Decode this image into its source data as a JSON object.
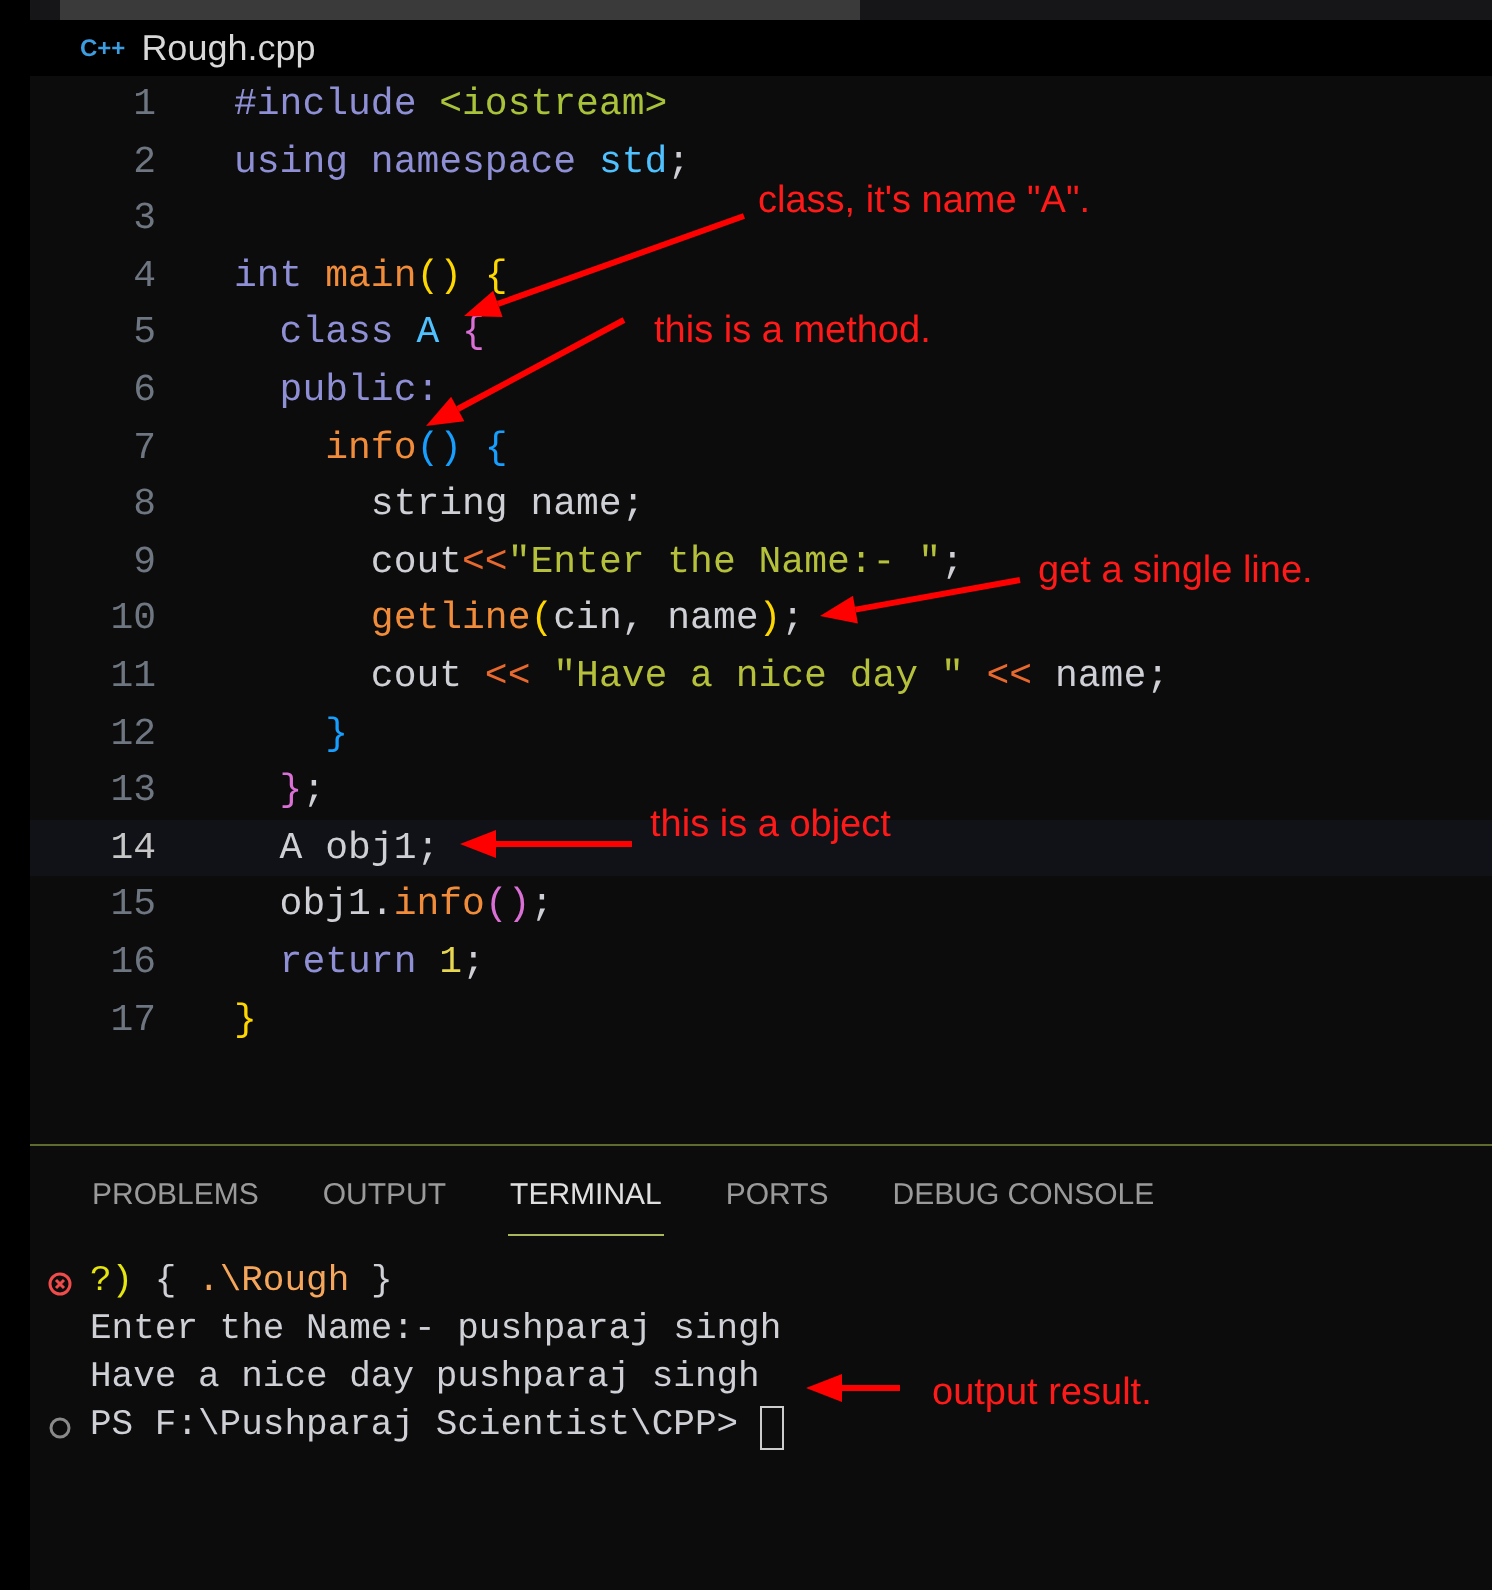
{
  "editor_tab": {
    "icon_text": "C++",
    "title": "Rough.cpp"
  },
  "code_lines": [
    {
      "number": "1",
      "selected": false,
      "tokens": [
        {
          "text": "#include ",
          "kind": "keyword"
        },
        {
          "text": "<iostream>",
          "kind": "include"
        }
      ]
    },
    {
      "number": "2",
      "selected": false,
      "tokens": [
        {
          "text": "using namespace ",
          "kind": "keyword"
        },
        {
          "text": "std",
          "kind": "type"
        },
        {
          "text": ";",
          "kind": "plain"
        }
      ]
    },
    {
      "number": "3",
      "selected": false
    },
    {
      "number": "4",
      "selected": false,
      "tokens": [
        {
          "text": "int ",
          "kind": "keyword"
        },
        {
          "text": "main",
          "kind": "function"
        },
        {
          "text": "() {",
          "kind": "bracket1"
        }
      ]
    },
    {
      "number": "5",
      "selected": false,
      "tokens": [
        {
          "text": "  class ",
          "kind": "keyword"
        },
        {
          "text": "A ",
          "kind": "type"
        },
        {
          "text": "{",
          "kind": "bracket2"
        }
      ]
    },
    {
      "number": "6",
      "selected": false,
      "tokens": [
        {
          "text": "  public:",
          "kind": "keyword"
        }
      ]
    },
    {
      "number": "7",
      "selected": false,
      "tokens": [
        {
          "text": "    info",
          "kind": "function"
        },
        {
          "text": "() {",
          "kind": "bracket3"
        }
      ]
    },
    {
      "number": "8",
      "selected": false,
      "tokens": [
        {
          "text": "      string name;",
          "kind": "plain"
        }
      ]
    },
    {
      "number": "9",
      "selected": false,
      "tokens": [
        {
          "text": "      cout",
          "kind": "plain"
        },
        {
          "text": "<<",
          "kind": "operator"
        },
        {
          "text": "\"Enter the Name:- \"",
          "kind": "string"
        },
        {
          "text": ";",
          "kind": "plain"
        }
      ]
    },
    {
      "number": "10",
      "selected": false,
      "tokens": [
        {
          "text": "      getline",
          "kind": "function"
        },
        {
          "text": "(",
          "kind": "bracket1"
        },
        {
          "text": "cin, name",
          "kind": "plain"
        },
        {
          "text": ")",
          "kind": "bracket1"
        },
        {
          "text": ";",
          "kind": "plain"
        }
      ]
    },
    {
      "number": "11",
      "selected": false,
      "tokens": [
        {
          "text": "      cout ",
          "kind": "plain"
        },
        {
          "text": "<< ",
          "kind": "operator"
        },
        {
          "text": "\"Have a nice day \" ",
          "kind": "string"
        },
        {
          "text": "<< ",
          "kind": "operator"
        },
        {
          "text": "name;",
          "kind": "plain"
        }
      ]
    },
    {
      "number": "12",
      "selected": false,
      "tokens": [
        {
          "text": "    }",
          "kind": "bracket3"
        }
      ]
    },
    {
      "number": "13",
      "selected": false,
      "tokens": [
        {
          "text": "  }",
          "kind": "bracket2"
        },
        {
          "text": ";",
          "kind": "plain"
        }
      ]
    },
    {
      "number": "14",
      "selected": true,
      "tokens": [
        {
          "text": "  A obj1;",
          "kind": "plain"
        }
      ]
    },
    {
      "number": "15",
      "selected": false,
      "tokens": [
        {
          "text": "  obj1.",
          "kind": "plain"
        },
        {
          "text": "info",
          "kind": "function"
        },
        {
          "text": "()",
          "kind": "bracket2"
        },
        {
          "text": ";",
          "kind": "plain"
        }
      ]
    },
    {
      "number": "16",
      "selected": false,
      "tokens": [
        {
          "text": "  return ",
          "kind": "keyword"
        },
        {
          "text": "1",
          "kind": "number"
        },
        {
          "text": ";",
          "kind": "plain"
        }
      ]
    },
    {
      "number": "17",
      "selected": false,
      "tokens": [
        {
          "text": "}",
          "kind": "bracket1"
        }
      ]
    }
  ],
  "panel_tabs": [
    {
      "label": "PROBLEMS",
      "selected": false
    },
    {
      "label": "OUTPUT",
      "selected": false
    },
    {
      "label": "TERMINAL",
      "selected": true
    },
    {
      "label": "PORTS",
      "selected": false
    },
    {
      "label": "DEBUG CONSOLE",
      "selected": false
    }
  ],
  "terminal_lines": [
    {
      "kind": "error",
      "cursor": false,
      "tokens": [
        {
          "text": "?)",
          "kind": "yellow"
        },
        {
          "text": " { ",
          "kind": "plain"
        },
        {
          "text": ".\\Rough",
          "kind": "orange"
        },
        {
          "text": " }",
          "kind": "plain"
        }
      ]
    },
    {
      "kind": "output",
      "cursor": false,
      "tokens": [
        {
          "text": "Enter the Name:- pushparaj singh",
          "kind": "plain"
        }
      ]
    },
    {
      "kind": "output",
      "cursor": false,
      "tokens": [
        {
          "text": "Have a nice day pushparaj singh",
          "kind": "plain"
        }
      ]
    },
    {
      "kind": "prompt",
      "cursor": true,
      "tokens": [
        {
          "text": "PS F:\\Pushparaj Scientist\\CPP> ",
          "kind": "plain"
        }
      ]
    }
  ],
  "annotations": [
    "class, it's name \"A\".",
    "this is a method.",
    "get a single line.",
    "this is a object",
    "output result."
  ]
}
